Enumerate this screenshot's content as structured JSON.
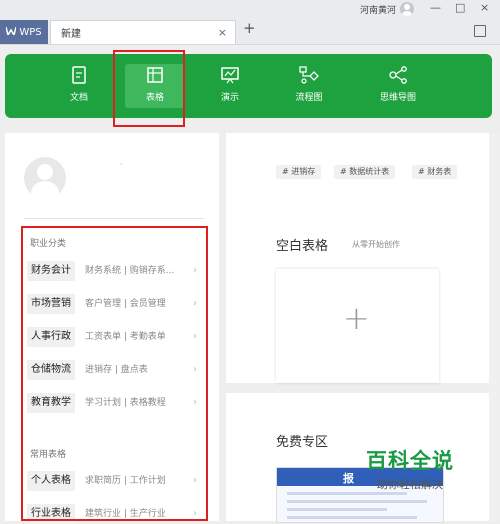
{
  "titlebar": {
    "wps_label": "WPS",
    "tab_label": "新建",
    "tab_close": "×",
    "new_tab": "+",
    "user_name": "河南黄河",
    "win_min": "—",
    "win_max": "□",
    "win_close": "×"
  },
  "toolbar": {
    "items": [
      {
        "label": "文档"
      },
      {
        "label": "表格"
      },
      {
        "label": "演示"
      },
      {
        "label": "流程图"
      },
      {
        "label": "思维导图"
      }
    ]
  },
  "sidebar": {
    "dot": "·",
    "section1": "职业分类",
    "section2": "常用表格",
    "rows": [
      {
        "cat": "财务会计",
        "sub": "财务系统  |  购销存系..."
      },
      {
        "cat": "市场营销",
        "sub": "客户管理  |  会员管理"
      },
      {
        "cat": "人事行政",
        "sub": "工资表单  |  考勤表单"
      },
      {
        "cat": "仓储物流",
        "sub": "进销存  |  盘点表"
      },
      {
        "cat": "教育教学",
        "sub": "学习计划  |  表格教程"
      },
      {
        "cat": "个人表格",
        "sub": "求职简历  |  工作计划"
      },
      {
        "cat": "行业表格",
        "sub": "建筑行业  |  生产行业"
      }
    ],
    "chevron": "›"
  },
  "main": {
    "tags": [
      "# 进销存",
      "# 数据统计表",
      "# 财务表"
    ],
    "blank_title": "空白表格",
    "blank_sub": "从零开始创作",
    "blank_plus": "+",
    "free_title": "免费专区",
    "thumb_text": "报"
  },
  "watermark": {
    "line1": "百科全说",
    "line2": "助你轻松解决"
  },
  "colors": {
    "accent_green": "#1ea23f",
    "highlight_red": "#e02020",
    "tab_blue": "#5b6f9c"
  }
}
